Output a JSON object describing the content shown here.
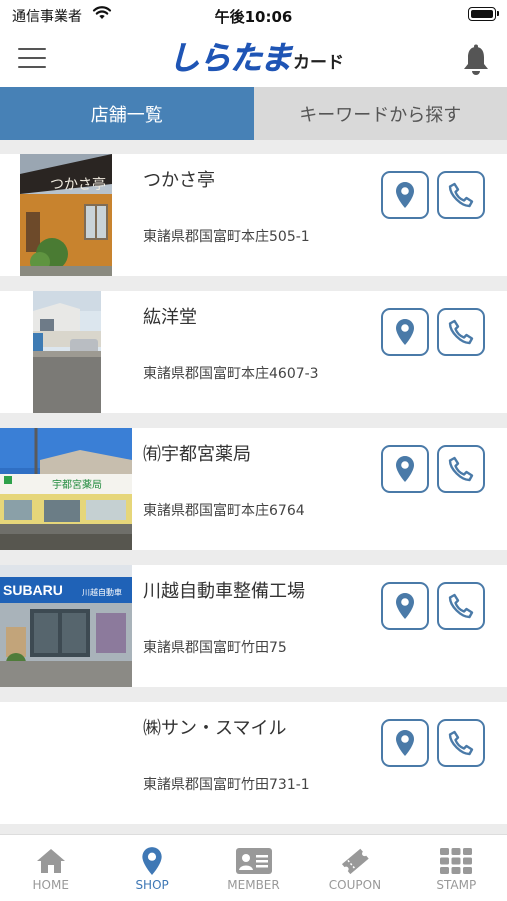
{
  "status_bar": {
    "carrier": "通信事業者",
    "time": "午後10:06"
  },
  "header": {
    "logo_main": "しらたま",
    "logo_sub": "カード"
  },
  "tabs": [
    {
      "label": "店舗一覧",
      "active": true
    },
    {
      "label": "キーワードから探す",
      "active": false
    }
  ],
  "shops": [
    {
      "name": "つかさ亭",
      "address": "東諸県郡国富町本庄505-1"
    },
    {
      "name": "紘洋堂",
      "address": "東諸県郡国富町本庄4607-3"
    },
    {
      "name": "㈲宇都宮薬局",
      "address": "東諸県郡国富町本庄6764"
    },
    {
      "name": "川越自動車整備工場",
      "address": "東諸県郡国富町竹田75"
    },
    {
      "name": "㈱サン・スマイル",
      "address": "東諸県郡国富町竹田731-1"
    }
  ],
  "photo_text": {
    "tsukasa_sign": "つかさ亭",
    "subaru": "SUBARU",
    "kawagoe": "川越自動車",
    "pharmacy": "宇都宮薬局"
  },
  "tabbar": [
    {
      "label": "HOME",
      "icon": "home-icon",
      "active": false
    },
    {
      "label": "SHOP",
      "icon": "map-pin-icon",
      "active": true
    },
    {
      "label": "MEMBER",
      "icon": "member-card-icon",
      "active": false
    },
    {
      "label": "COUPON",
      "icon": "ticket-icon",
      "active": false
    },
    {
      "label": "STAMP",
      "icon": "stamp-grid-icon",
      "active": false
    }
  ],
  "colors": {
    "accent": "#4781b6",
    "icon_blue": "#4a7aa8",
    "inactive_tab": "#d9d9d9",
    "background": "#ececec"
  }
}
